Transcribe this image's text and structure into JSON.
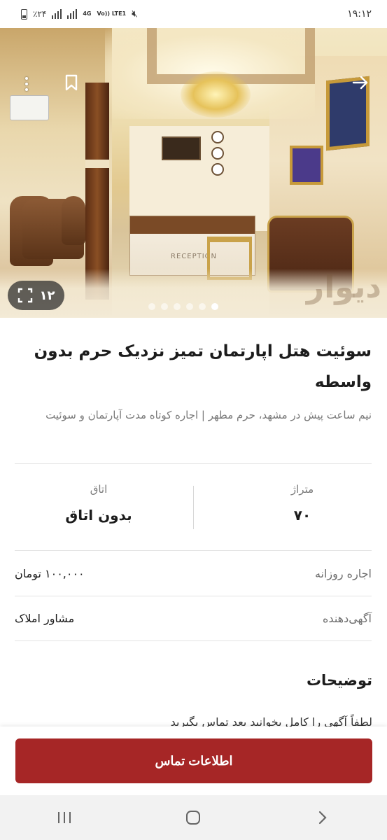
{
  "status_bar": {
    "battery": "٪۲۴",
    "network": "4G",
    "network2": "Vo)) LTE1",
    "time": "۱۹:۱۲"
  },
  "hero": {
    "photo_count": "۱۲",
    "desk_label": "RECEPTION",
    "watermark": "دیوار",
    "pager_total": 6,
    "pager_active": 5
  },
  "listing": {
    "title": "سوئیت  هتل  اپارتمان  تمیز نزدیک حرم  بدون واسطه",
    "subtitle": "نیم ساعت پیش در مشهد، حرم مطهر | اجاره کوتاه مدت آپارتمان و سوئیت",
    "stats": [
      {
        "label": "متراژ",
        "value": "۷۰"
      },
      {
        "label": "اتاق",
        "value": "بدون اتاق"
      }
    ],
    "rows": [
      {
        "key": "اجاره روزانه",
        "value": "۱۰۰,۰۰۰ تومان"
      },
      {
        "key": "آگهی‌دهنده",
        "value": "مشاور املاک"
      }
    ],
    "description_title": "توضیحات",
    "description_text": "لطفاً آگهی را کامل بخوانید بعد تماس بگیرید"
  },
  "cta": {
    "label": "اطلاعات تماس",
    "color": "#a62626"
  },
  "colors": {
    "accent": "#a62626",
    "nav_bg": "#f2f2f2"
  }
}
